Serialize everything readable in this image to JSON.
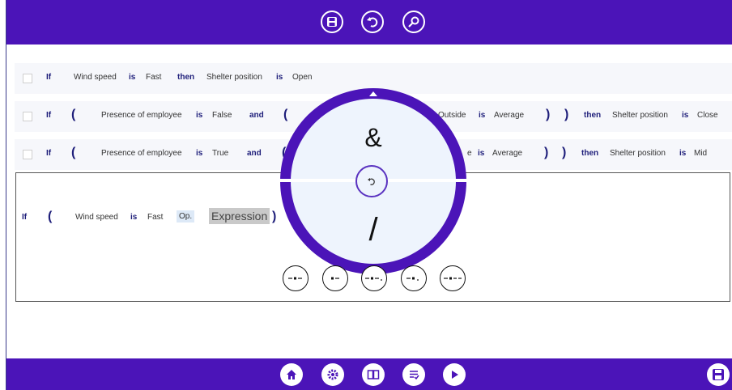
{
  "toolbar_top": {
    "buttons": [
      "save-icon",
      "undo-icon",
      "search-icon"
    ]
  },
  "rules": [
    {
      "tokens": [
        {
          "text": "If",
          "kind": "kw"
        },
        {
          "text": "Wind speed",
          "kind": "t"
        },
        {
          "text": "is",
          "kind": "kw"
        },
        {
          "text": "Fast",
          "kind": "t"
        },
        {
          "text": "then",
          "kind": "kw"
        },
        {
          "text": "Shelter position",
          "kind": "t"
        },
        {
          "text": "is",
          "kind": "kw"
        },
        {
          "text": "Open",
          "kind": "t"
        }
      ]
    },
    {
      "tokens": [
        {
          "text": "If",
          "kind": "kw"
        },
        {
          "text": "(",
          "kind": "p"
        },
        {
          "text": "Presence of employee",
          "kind": "t"
        },
        {
          "text": "is",
          "kind": "kw"
        },
        {
          "text": "False",
          "kind": "t"
        },
        {
          "text": "and",
          "kind": "kw"
        },
        {
          "text": "(",
          "kind": "p"
        },
        {
          "text": "Outside",
          "kind": "t"
        },
        {
          "text": "is",
          "kind": "kw"
        },
        {
          "text": "Average",
          "kind": "t"
        },
        {
          "text": ")",
          "kind": "p"
        },
        {
          "text": ")",
          "kind": "p"
        },
        {
          "text": "then",
          "kind": "kw"
        },
        {
          "text": "Shelter position",
          "kind": "t"
        },
        {
          "text": "is",
          "kind": "kw"
        },
        {
          "text": "Close",
          "kind": "t"
        }
      ]
    },
    {
      "tokens": [
        {
          "text": "If",
          "kind": "kw"
        },
        {
          "text": "(",
          "kind": "p"
        },
        {
          "text": "Presence of employee",
          "kind": "t"
        },
        {
          "text": "is",
          "kind": "kw"
        },
        {
          "text": "True",
          "kind": "t"
        },
        {
          "text": "and",
          "kind": "kw"
        },
        {
          "text": "(",
          "kind": "p"
        },
        {
          "text": "e",
          "kind": "t"
        },
        {
          "text": "is",
          "kind": "kw"
        },
        {
          "text": "Average",
          "kind": "t"
        },
        {
          "text": ")",
          "kind": "p"
        },
        {
          "text": ")",
          "kind": "p"
        },
        {
          "text": "then",
          "kind": "kw"
        },
        {
          "text": "Shelter position",
          "kind": "t"
        },
        {
          "text": "is",
          "kind": "kw"
        },
        {
          "text": "Mid",
          "kind": "t"
        }
      ]
    }
  ],
  "editor": {
    "if": "If",
    "open_paren": "(",
    "variable": "Wind speed",
    "is": "is",
    "value": "Fast",
    "op_placeholder": "Op.",
    "expr_placeholder": "Expression",
    "close_paren": ")"
  },
  "wheel": {
    "top_symbol": "&",
    "bottom_symbol": "/",
    "center_icon": "undo-icon"
  },
  "strokes": [
    "-•-",
    "•-",
    "-•-.",
    "-•.",
    "-•--"
  ],
  "toolbar_bottom": {
    "buttons": [
      "home-icon",
      "settings-icon",
      "book-icon",
      "checklist-icon",
      "play-icon"
    ],
    "right": "save-icon"
  },
  "colors": {
    "accent": "#4b14b8",
    "keyword": "#1e1e7a"
  }
}
